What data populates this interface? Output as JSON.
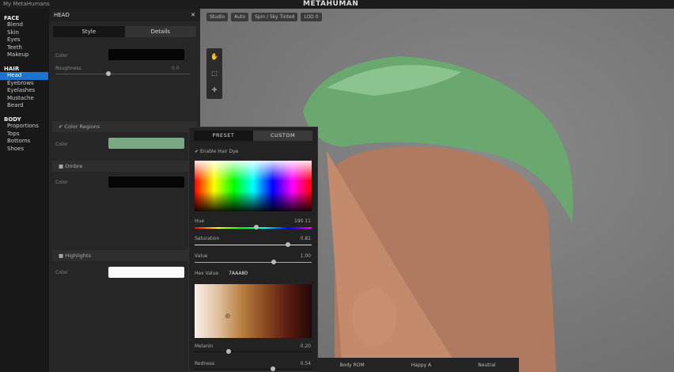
{
  "app": {
    "title": "My MetaHumans",
    "logo": "METAHUMAN"
  },
  "nav": [
    {
      "section": "FACE",
      "items": [
        "Blend",
        "Skin",
        "Eyes",
        "Teeth",
        "Makeup"
      ]
    },
    {
      "section": "HAIR",
      "items": [
        "Head",
        "Eyebrows",
        "Eyelashes",
        "Mustache",
        "Beard"
      ],
      "active": "Head"
    },
    {
      "section": "BODY",
      "items": [
        "Proportions",
        "Tops",
        "Bottoms",
        "Shoes"
      ]
    }
  ],
  "panel": {
    "title": "HEAD",
    "tabs": [
      "Style",
      "Details"
    ],
    "color_label": "Color",
    "roughness_label": "Roughness",
    "roughness_value": "0.0",
    "color_regions_label": "Color Regions",
    "regions_color_label": "Color",
    "ombre_label": "Ombre",
    "ombre_color_label": "Color",
    "highlights_label": "Highlights",
    "highlights_color_label": "Color"
  },
  "viewport": {
    "toolbar": [
      "Studio",
      "Auto",
      "Spin / Sky Tinted",
      "LOD 0"
    ],
    "side_tools": [
      "✋",
      "⬚",
      "✛"
    ]
  },
  "picker": {
    "tabs": [
      "PRESET",
      "CUSTOM"
    ],
    "enable_label": "Enable Hair Dye",
    "hue_label": "Hue",
    "hue_value": "190.11",
    "hue": 0.53,
    "saturation_label": "Saturation",
    "saturation_value": "0.81",
    "saturation": 0.81,
    "value_label": "Value",
    "value_value": "1.00",
    "value": 0.68,
    "hex_label": "Hex Value",
    "hex_value": "7AAA80",
    "melanin_label": "Melanin",
    "melanin_value": "0.20",
    "redness_label": "Redness",
    "redness_value": "0.54"
  },
  "bottom": [
    "Body ROM",
    "Happy A",
    "Neutral"
  ],
  "colors": {
    "hair": "#6aa870",
    "accent": "#1a74d0"
  }
}
